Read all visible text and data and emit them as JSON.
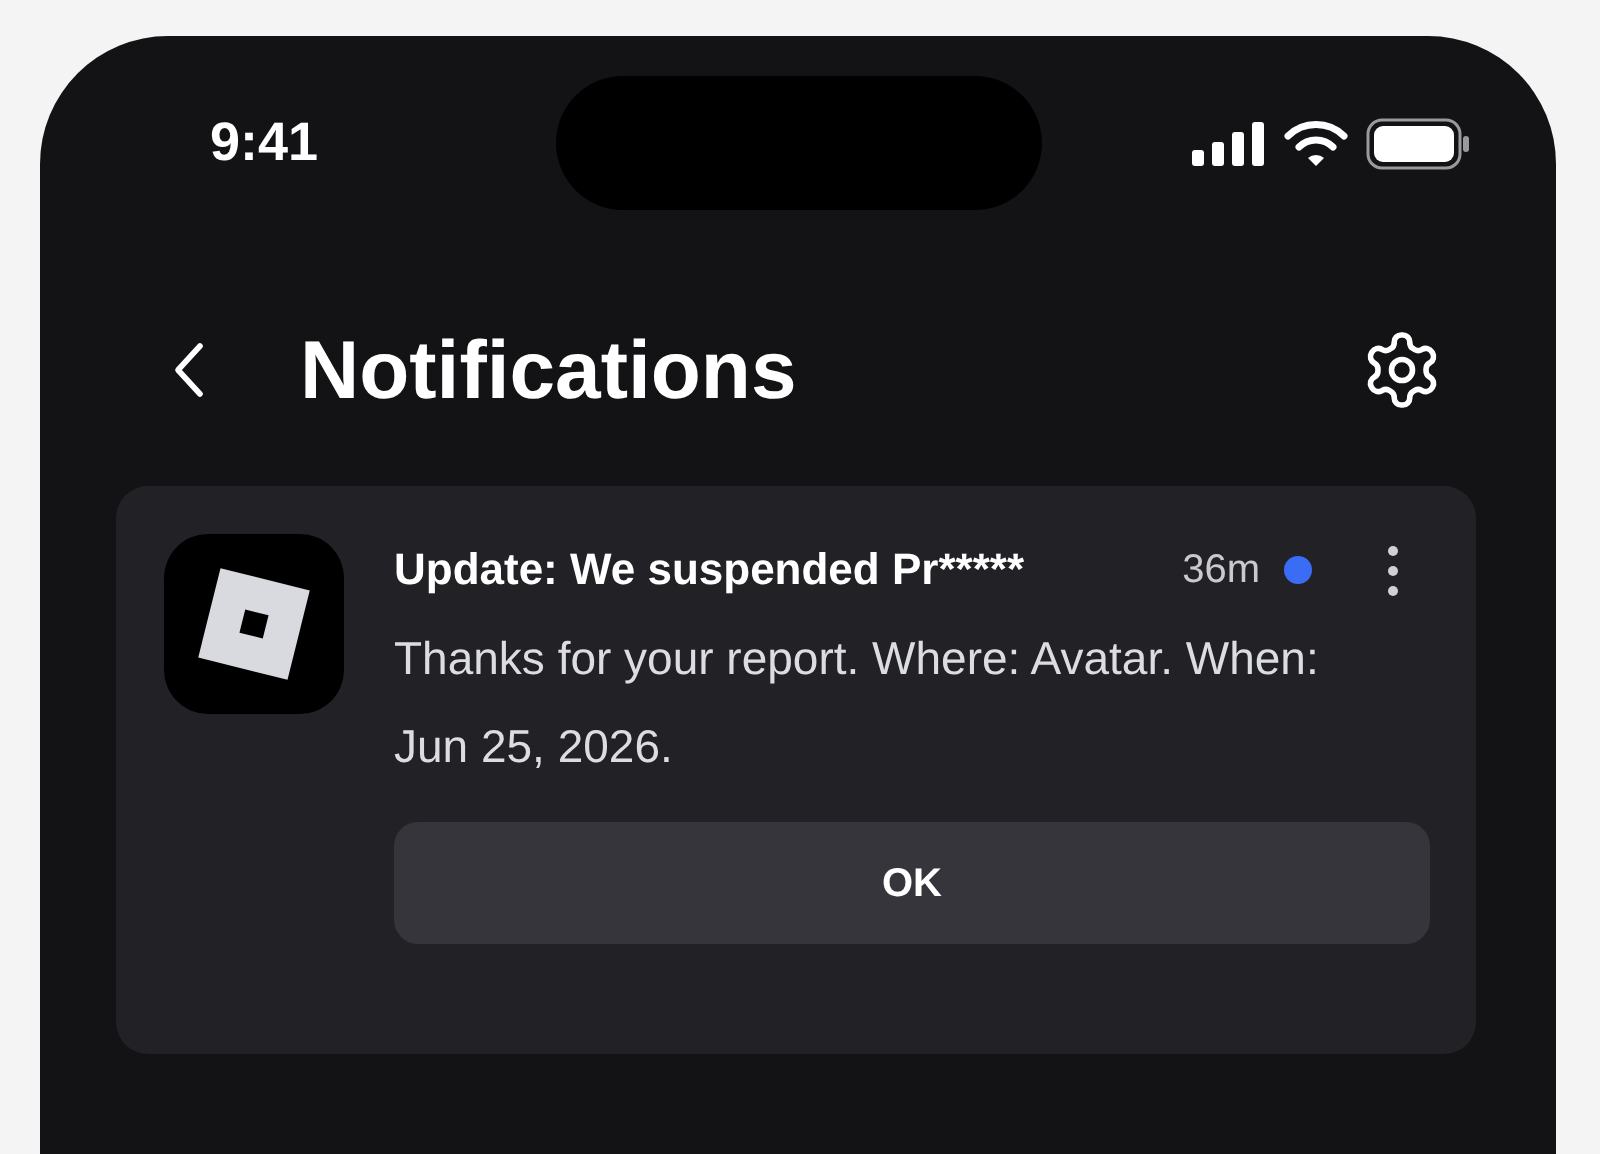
{
  "status_bar": {
    "time": "9:41"
  },
  "header": {
    "title": "Notifications"
  },
  "notifications": [
    {
      "title": "Update: We suspended Pr*****",
      "time": "36m",
      "unread": true,
      "body": "Thanks for your report. Where: Avatar. When: Jun 25, 2026.",
      "button": "OK"
    }
  ]
}
